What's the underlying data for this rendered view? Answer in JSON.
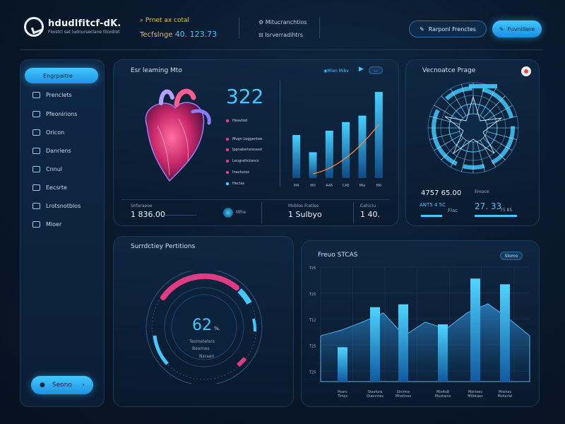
{
  "header": {
    "brand_title": "hdudlfitcf-dK.",
    "brand_subtitle": "Fkostcl sat ludnurseclane thixdret",
    "search_text": "Prnet ax cotal",
    "stat_label": "Tecfslnge",
    "stat_value": "40. 123.73",
    "item1": "Mitucranchtios",
    "item2": "Isrverradihtrs",
    "btn_outline": "Rarponl Frenctes",
    "btn_primary": "Fuvnlilere"
  },
  "sidebar": {
    "active": "Engrpaitre",
    "items": [
      "Prenclets",
      "Pfeonirions",
      "Oricon",
      "Danriens",
      "Cnnul",
      "Eecsrte",
      "Lrotsnotblos",
      "Mloer"
    ],
    "bottom_button": "Seono"
  },
  "heart_card": {
    "title": "Esr leaming Mto",
    "pill": "Mien Mibv",
    "number": "322",
    "legend": [
      "Heavtod",
      "Mugn Leggantoo",
      "Ippnaterisrecesd",
      "Lengrattctancs",
      "Inactucos",
      "Hectas"
    ],
    "chart_ticks": [
      "M4",
      "M0",
      "A45",
      "CAE",
      "Mle",
      "M0"
    ],
    "stat1_label": "Snfaraeoe",
    "stat1_value": "1 836.00",
    "stat2_label": "Mlhe",
    "stat3_label": "Moblos Fratlso",
    "stat3_value": "1 Sulbyo",
    "stat4_label": "Cahiciu",
    "stat4_value": "1 40."
  },
  "radar_card": {
    "title": "Vecnoatce Prage",
    "stat1_value": "4757 65.00",
    "stat1_tag": "ANT5 4 5C",
    "stat1_sub": "Flac",
    "stat2_label": "Ereace",
    "stat2_value": "27. 33",
    "stat2_sub": "75 85"
  },
  "gauge_card": {
    "title": "Surrdctiey Pertitions",
    "value": "62",
    "unit": "%.",
    "sub1": "Tesmetelors",
    "sub2": "Bearnes",
    "sub3": "Nsraen"
  },
  "area_card": {
    "title": "Freuo STCAS",
    "pill": "Slomo",
    "y_ticks": [
      "T25",
      "T25",
      "T12",
      "T25",
      "T25"
    ],
    "x_ticks": [
      [
        "Pearc",
        "Tirtos"
      ],
      [
        "Sloafuro",
        "Ouenntes"
      ],
      [
        "Slnirme",
        "Mlostnes"
      ],
      [
        "Mlo4o8",
        "Muvtanis"
      ],
      [
        "Mertees",
        "Mtlotaes"
      ],
      [
        "Mrehes",
        "Mvilarlal"
      ]
    ]
  },
  "chart_data": [
    {
      "type": "bar",
      "categories": [
        "M4",
        "M0",
        "A45",
        "CAE",
        "Mle",
        "M0"
      ],
      "values": [
        20,
        12,
        22,
        26,
        29,
        40
      ],
      "ylim": [
        0,
        42
      ]
    },
    {
      "type": "bar",
      "values": [
        12,
        26,
        27,
        20,
        36,
        34
      ],
      "area": [
        40,
        45,
        52,
        60,
        40,
        52,
        46,
        60,
        68,
        55,
        40
      ],
      "ylim": [
        0,
        100
      ]
    }
  ],
  "colors": {
    "accent": "#40c8ff",
    "pink": "#e23b85",
    "gold": "#e0c060",
    "bg": "#0a1a2e"
  }
}
